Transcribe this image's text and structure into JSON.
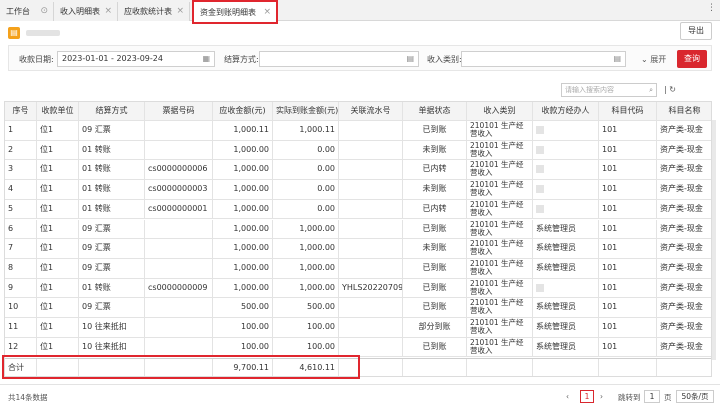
{
  "tabs": [
    {
      "label": "工作台"
    },
    {
      "label": "收入明细表"
    },
    {
      "label": "应收款统计表"
    },
    {
      "label": "资金到账明细表"
    }
  ],
  "toolbar": {
    "export": "导出"
  },
  "filters": {
    "date_label": "收款日期:",
    "date_value": "2023-01-01 - 2023-09-24",
    "settle_label": "结算方式:",
    "settle_value": "",
    "category_label": "收入类别:",
    "category_value": "",
    "expand": "展开",
    "query": "查询"
  },
  "search": {
    "placeholder": "请输入搜索内容"
  },
  "columns": [
    "序号",
    "收款单位",
    "结算方式",
    "票据号码",
    "应收金额(元)",
    "实际到账金额(元)",
    "关联流水号",
    "单据状态",
    "收入类别",
    "收款方经办人",
    "科目代码",
    "科目名称"
  ],
  "rows": [
    [
      "1",
      "位1",
      "09 汇票",
      "",
      "1,000.11",
      "1,000.11",
      "",
      "已到账",
      "210101 生产经营收入",
      "",
      "101",
      "资产类-现金"
    ],
    [
      "2",
      "位1",
      "01 转账",
      "",
      "1,000.00",
      "0.00",
      "",
      "未到账",
      "210101 生产经营收入",
      "",
      "101",
      "资产类-现金"
    ],
    [
      "3",
      "位1",
      "01 转账",
      "cs0000000006",
      "1,000.00",
      "0.00",
      "",
      "已内转",
      "210101 生产经营收入",
      "",
      "101",
      "资产类-现金"
    ],
    [
      "4",
      "位1",
      "01 转账",
      "cs0000000003",
      "1,000.00",
      "0.00",
      "",
      "未到账",
      "210101 生产经营收入",
      "",
      "101",
      "资产类-现金"
    ],
    [
      "5",
      "位1",
      "01 转账",
      "cs0000000001",
      "1,000.00",
      "0.00",
      "",
      "已内转",
      "210101 生产经营收入",
      "",
      "101",
      "资产类-现金"
    ],
    [
      "6",
      "位1",
      "09 汇票",
      "",
      "1,000.00",
      "1,000.00",
      "",
      "已到账",
      "210101 生产经营收入",
      "系统管理员",
      "101",
      "资产类-现金"
    ],
    [
      "7",
      "位1",
      "09 汇票",
      "",
      "1,000.00",
      "1,000.00",
      "",
      "未到账",
      "210101 生产经营收入",
      "系统管理员",
      "101",
      "资产类-现金"
    ],
    [
      "8",
      "位1",
      "09 汇票",
      "",
      "1,000.00",
      "1,000.00",
      "",
      "已到账",
      "210101 生产经营收入",
      "系统管理员",
      "101",
      "资产类-现金"
    ],
    [
      "9",
      "位1",
      "01 转账",
      "cs0000000009",
      "1,000.00",
      "1,000.00",
      "YHLS20220709",
      "已到账",
      "210101 生产经营收入",
      "",
      "101",
      "资产类-现金"
    ],
    [
      "10",
      "位1",
      "09 汇票",
      "",
      "500.00",
      "500.00",
      "",
      "已到账",
      "210101 生产经营收入",
      "系统管理员",
      "101",
      "资产类-现金"
    ],
    [
      "11",
      "位1",
      "10 往来抵扣",
      "",
      "100.00",
      "100.00",
      "",
      "部分到账",
      "210101 生产经营收入",
      "系统管理员",
      "101",
      "资产类-现金"
    ],
    [
      "12",
      "位1",
      "10 往来抵扣",
      "",
      "100.00",
      "100.00",
      "",
      "已到账",
      "210101 生产经营收入",
      "系统管理员",
      "101",
      "资产类-现金"
    ]
  ],
  "total": {
    "label": "合计",
    "receivable": "9,700.11",
    "actual": "4,610.11"
  },
  "footer": {
    "count": "共14条数据",
    "page_label_pre": "跳转到",
    "page": "1",
    "page_label_post": "页",
    "page_size": "50条/页"
  }
}
